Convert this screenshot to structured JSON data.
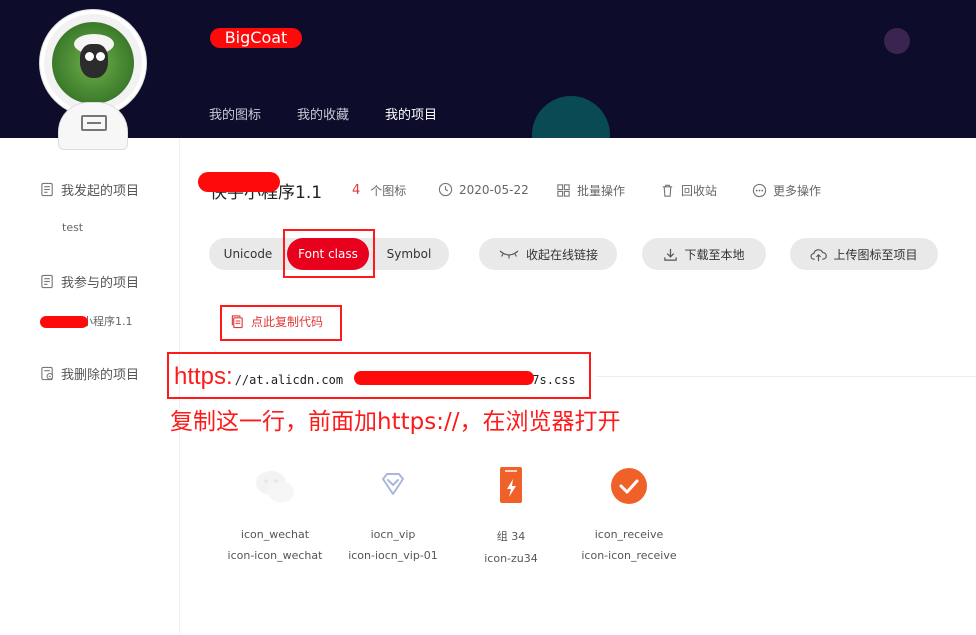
{
  "header": {
    "username": "BigCoat",
    "tabs": [
      {
        "label": "我的图标",
        "active": false
      },
      {
        "label": "我的收藏",
        "active": false
      },
      {
        "label": "我的项目",
        "active": true
      }
    ]
  },
  "sidebar": {
    "groups": [
      {
        "label": "我发起的项目",
        "icon": "document-icon",
        "items": [
          "test"
        ]
      },
      {
        "label": "我参与的项目",
        "icon": "document-icon",
        "items": [
          "小程序1.1"
        ]
      },
      {
        "label": "我删除的项目",
        "icon": "trash-document-icon",
        "items": []
      }
    ]
  },
  "project": {
    "title": "快手小程序1.1",
    "icon_count": "4",
    "icon_count_label": "个图标",
    "date": "2020-05-22",
    "batch_label": "批量操作",
    "recycle_label": "回收站",
    "more_label": "更多操作"
  },
  "modes": {
    "unicode": "Unicode",
    "fontclass": "Font class",
    "symbol": "Symbol",
    "active": "fontclass"
  },
  "actions": {
    "collapse_link": "收起在线链接",
    "download": "下载至本地",
    "upload": "上传图标至项目"
  },
  "link": {
    "copy_label": "点此复制代码",
    "https_prefix": "https:",
    "url_start": "//at.alicdn.com",
    "url_end": "17s.css"
  },
  "annotation": {
    "instruction": "复制这一行，前面加https://，在浏览器打开"
  },
  "icons": [
    {
      "name": "icon_wechat",
      "class": "icon-icon_wechat",
      "glyph": "wechat-icon"
    },
    {
      "name": "iocn_vip",
      "class": "icon-iocn_vip-01",
      "glyph": "vip-diamond-icon"
    },
    {
      "name": "组 34",
      "class": "icon-zu34",
      "glyph": "phone-flash-icon"
    },
    {
      "name": "icon_receive",
      "class": "icon-icon_receive",
      "glyph": "receive-check-icon"
    }
  ],
  "colors": {
    "header_bg": "#0d0c2b",
    "accent_red": "#e8001c",
    "annotation_red": "#ff1a1a",
    "orange": "#f0612a"
  }
}
